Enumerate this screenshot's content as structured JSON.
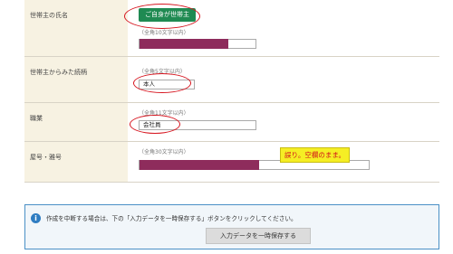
{
  "rows": [
    {
      "label": "世帯主の氏名",
      "badge": "ご自身が世帯主",
      "hint": "（全角10文字以内）"
    },
    {
      "label": "世帯主からみた続柄",
      "hint": "（全角5文字以内）",
      "value": "本人"
    },
    {
      "label": "職業",
      "hint": "（全角11文字以内）",
      "value": "会社員"
    },
    {
      "label": "屋号・雅号",
      "hint": "（全角30文字以内）",
      "note": "誤り。空欄のまま。"
    }
  ],
  "info": {
    "message": "作成を中断する場合は、下の「入力データを一時保存する」ボタンをクリックしてください。",
    "save_button": "入力データを一時保存する"
  },
  "colors": {
    "label_bg": "#f7f2e2",
    "badge_green": "#1f8a52",
    "annotation_red": "#d6141e",
    "note_yellow": "#f5ee24",
    "redaction": "#8e2c5c",
    "info_border": "#4a90c6"
  }
}
